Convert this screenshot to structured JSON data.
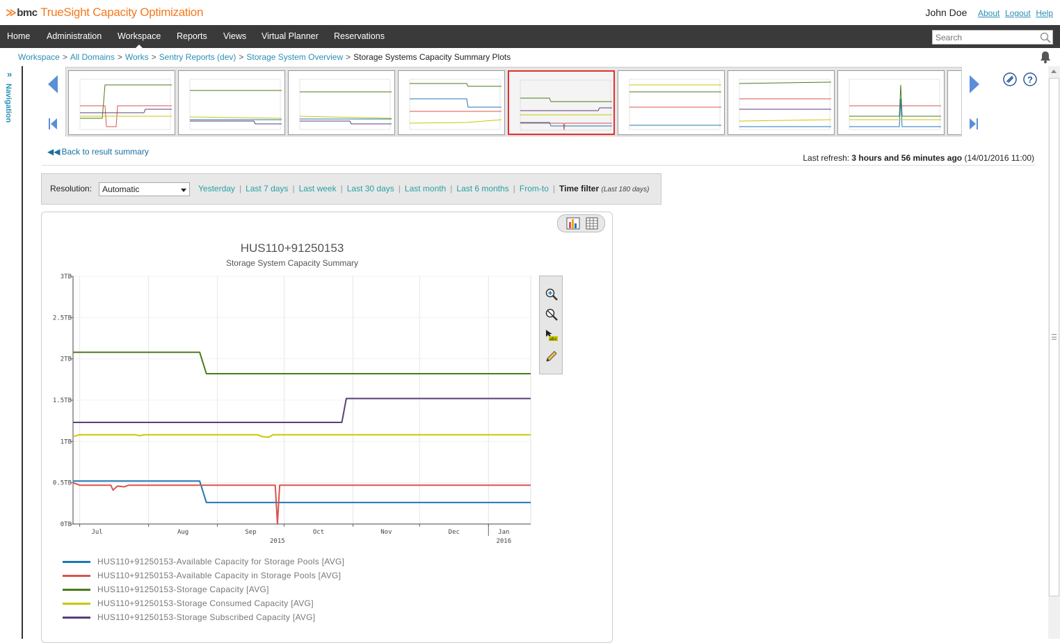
{
  "header": {
    "logo_bmc": "bmc",
    "logo_product": "TrueSight Capacity Optimization",
    "user": "John Doe",
    "links": [
      "About",
      "Logout",
      "Help"
    ]
  },
  "nav": {
    "items": [
      "Home",
      "Administration",
      "Workspace",
      "Reports",
      "Views",
      "Virtual Planner",
      "Reservations"
    ],
    "active": "Workspace",
    "search_placeholder": "Search"
  },
  "breadcrumb": {
    "items": [
      "Workspace",
      "All Domains",
      "Works",
      "Sentry Reports (dev)",
      "Storage System Overview"
    ],
    "current": "Storage Systems Capacity Summary Plots"
  },
  "left_nav": {
    "label": "Navigation"
  },
  "back_link": "Back to result summary",
  "last_refresh": {
    "label": "Last refresh:",
    "value": "3 hours and 56 minutes ago",
    "timestamp": "(14/01/2016 11:00)"
  },
  "time_filter": {
    "resolution_label": "Resolution:",
    "resolution_value": "Automatic",
    "ranges": [
      "Yesterday",
      "Last 7 days",
      "Last week",
      "Last 30 days",
      "Last month",
      "Last 6 months",
      "From-to"
    ],
    "filter_label": "Time filter",
    "filter_sub": "(Last 180 days)"
  },
  "colors": {
    "blue": "#1f77b4",
    "red": "#d9534f",
    "green": "#4a7a1a",
    "yellow": "#c8c800",
    "purple": "#5a3d7a",
    "accent": "#f47920",
    "link": "#2a8fb5"
  },
  "chart_data": {
    "type": "line",
    "title": "HUS110+91250153",
    "subtitle": "Storage System Capacity Summary",
    "y_unit": "TB",
    "ylim": [
      0,
      3
    ],
    "yticks": [
      0,
      0.5,
      1,
      1.5,
      2,
      2.5,
      3
    ],
    "ytick_labels": [
      "0TB",
      "0.5TB",
      "1TB",
      "1.5TB",
      "2TB",
      "2.5TB",
      "3TB"
    ],
    "xlim": [
      "2015-06-28",
      "2016-01-20"
    ],
    "xticks": [
      {
        "date": "2015-07-01",
        "label": "Jul"
      },
      {
        "date": "2015-08-01",
        "label": "Aug"
      },
      {
        "date": "2015-09-01",
        "label": "Sep"
      },
      {
        "date": "2015-10-01",
        "label": "Oct"
      },
      {
        "date": "2015-11-01",
        "label": "Nov"
      },
      {
        "date": "2015-12-01",
        "label": "Dec"
      },
      {
        "date": "2016-01-01",
        "label": "Jan"
      }
    ],
    "year_labels": [
      {
        "date": "2015-09-28",
        "label": "2015"
      },
      {
        "date": "2016-01-01",
        "label": "2016"
      }
    ],
    "grid": true,
    "legend_position": "bottom",
    "series": [
      {
        "name": "HUS110+91250153-Available Capacity for Storage Pools [AVG]",
        "color": "#1f77b4",
        "points": [
          [
            "2015-06-28",
            0.52
          ],
          [
            "2015-08-24",
            0.52
          ],
          [
            "2015-08-27",
            0.26
          ],
          [
            "2016-01-20",
            0.26
          ]
        ]
      },
      {
        "name": "HUS110+91250153-Available Capacity in Storage Pools [AVG]",
        "color": "#d9534f",
        "points": [
          [
            "2015-06-28",
            0.5
          ],
          [
            "2015-07-01",
            0.47
          ],
          [
            "2015-07-15",
            0.47
          ],
          [
            "2015-07-16",
            0.41
          ],
          [
            "2015-07-18",
            0.46
          ],
          [
            "2015-07-21",
            0.45
          ],
          [
            "2015-07-23",
            0.47
          ],
          [
            "2015-09-27",
            0.47
          ],
          [
            "2015-09-28",
            0.0
          ],
          [
            "2015-09-29",
            0.47
          ],
          [
            "2016-01-20",
            0.47
          ]
        ]
      },
      {
        "name": "HUS110+91250153-Storage Capacity [AVG]",
        "color": "#4a7a1a",
        "points": [
          [
            "2015-06-28",
            2.08
          ],
          [
            "2015-08-24",
            2.08
          ],
          [
            "2015-08-27",
            1.82
          ],
          [
            "2016-01-20",
            1.82
          ]
        ]
      },
      {
        "name": "HUS110+91250153-Storage Consumed Capacity [AVG]",
        "color": "#c8c800",
        "points": [
          [
            "2015-06-28",
            1.06
          ],
          [
            "2015-07-01",
            1.08
          ],
          [
            "2015-07-26",
            1.08
          ],
          [
            "2015-07-28",
            1.07
          ],
          [
            "2015-07-30",
            1.08
          ],
          [
            "2015-09-19",
            1.08
          ],
          [
            "2015-09-21",
            1.06
          ],
          [
            "2015-09-24",
            1.05
          ],
          [
            "2015-09-26",
            1.08
          ],
          [
            "2016-01-20",
            1.08
          ]
        ]
      },
      {
        "name": "HUS110+91250153-Storage Subscribed Capacity [AVG]",
        "color": "#5a3d7a",
        "points": [
          [
            "2015-06-28",
            1.23
          ],
          [
            "2015-10-27",
            1.23
          ],
          [
            "2015-10-29",
            1.52
          ],
          [
            "2016-01-20",
            1.52
          ]
        ]
      }
    ]
  }
}
